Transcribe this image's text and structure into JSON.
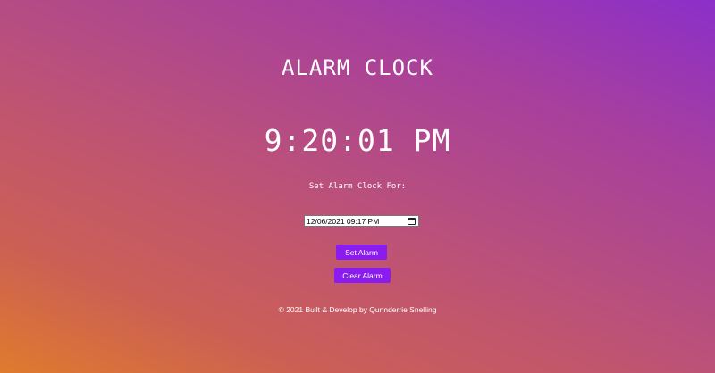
{
  "header": {
    "title": "ALARM CLOCK"
  },
  "clock": {
    "time": "9:20:01 PM"
  },
  "alarm_form": {
    "label": "Set Alarm Clock For:",
    "datetime_value": "12/06/2021 09:17 PM",
    "calendar_icon": "calendar-icon",
    "set_button": "Set Alarm",
    "clear_button": "Clear Alarm"
  },
  "footer": {
    "text": "© 2021 Built & Develop by Qunnderrie Snelling"
  },
  "colors": {
    "button": "#8a1cf0",
    "gradient_top_right": "#8b2fc9",
    "gradient_bottom_left": "#de7b2d",
    "text": "#ffffff"
  }
}
